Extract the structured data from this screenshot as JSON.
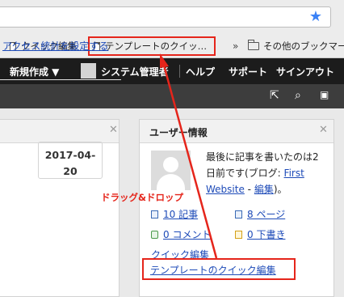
{
  "browser": {
    "bookmarks": [
      {
        "label": "クイック編集"
      },
      {
        "label": "テンプレートのクイッ…"
      },
      {
        "label": "その他のブックマー"
      }
    ],
    "overflow_chevron": "»"
  },
  "adminbar": {
    "new": "新規作成 ▼",
    "user": "システム管理者",
    "help": "ヘルプ",
    "support": "サポート",
    "logout": "サインアウト"
  },
  "left_panel": {
    "link": "アクセス統計を設定する",
    "date": "2017-04-\n20"
  },
  "user_panel": {
    "title": "ユーザー情報",
    "bio_prefix": "最後に記事を書いたのは2 日前です(ブログ: ",
    "blog_link": "First Website",
    "bio_sep": " - ",
    "edit_link": "編集",
    "bio_suffix": ")。",
    "stats": {
      "entries": "10 記事",
      "pages": "8 ページ",
      "comments": "0 コメント",
      "drafts": "0 下書き"
    },
    "quick_edit_title": "クイック編集",
    "quick_edit_link": "テンプレートのクイック編集"
  },
  "annotation": {
    "label": "ドラッグ&ドロップ",
    "color": "#e5251b"
  }
}
